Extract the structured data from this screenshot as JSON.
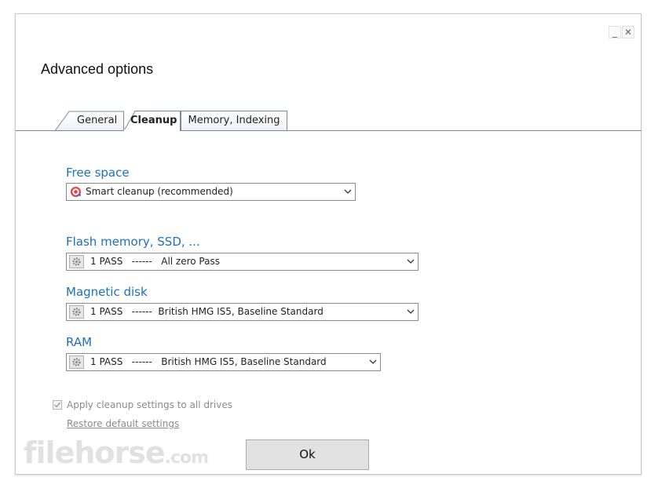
{
  "dialog": {
    "title": "Advanced options",
    "minimize_glyph": "_",
    "close_glyph": "✕"
  },
  "tabs": [
    {
      "label": "General",
      "active": false
    },
    {
      "label": "Cleanup",
      "active": true
    },
    {
      "label": "Memory, Indexing",
      "active": false
    }
  ],
  "free_space": {
    "label": "Free space",
    "value": "Smart cleanup (recommended)",
    "icon": "target-icon"
  },
  "flash": {
    "label": "Flash memory, SSD, ...",
    "value": "1 PASS   ------   All zero Pass",
    "icon": "gear-icon"
  },
  "magnetic": {
    "label": "Magnetic disk",
    "value": "1 PASS   ------  British HMG IS5, Baseline Standard",
    "icon": "gear-icon"
  },
  "ram": {
    "label": "RAM",
    "value": "1 PASS   ------   British HMG IS5, Baseline Standard",
    "icon": "gear-icon"
  },
  "apply_all": {
    "label": "Apply cleanup settings to all drives",
    "checked": true,
    "enabled": false
  },
  "restore_link": "Restore default settings",
  "ok_button": "Ok",
  "watermark": {
    "text": "filehorse",
    "suffix": ".com"
  },
  "colors": {
    "section_label": "#1e6fbf",
    "disabled_text": "#8a8a8a",
    "tab_line": "#6a8aa8"
  }
}
